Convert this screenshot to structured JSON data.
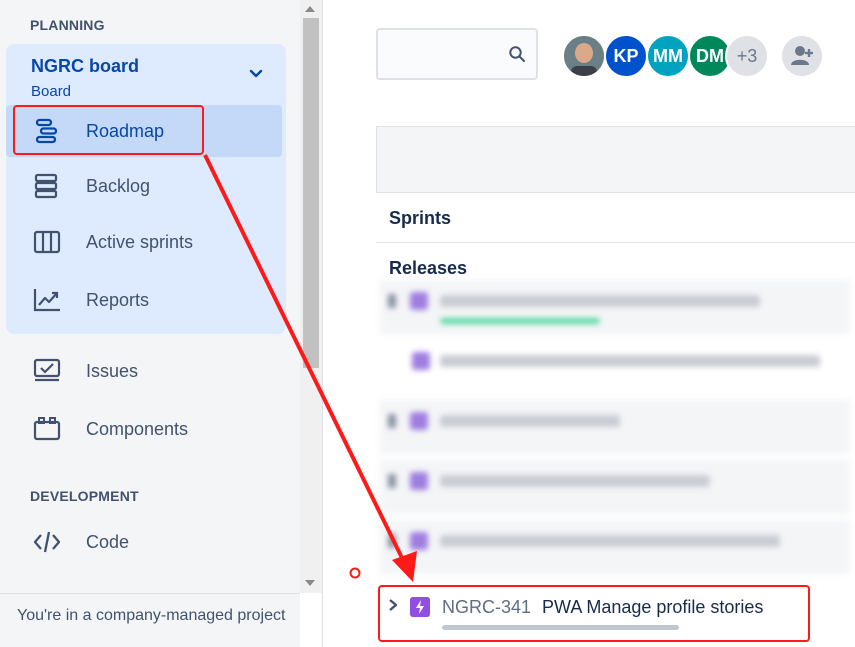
{
  "sidebar": {
    "planning_heading": "PLANNING",
    "board": {
      "title": "NGRC board",
      "subtitle": "Board"
    },
    "planning_items": [
      {
        "label": "Roadmap",
        "icon": "roadmap-icon",
        "active": true
      },
      {
        "label": "Backlog",
        "icon": "backlog-icon"
      },
      {
        "label": "Active sprints",
        "icon": "active-sprints-icon"
      },
      {
        "label": "Reports",
        "icon": "reports-icon"
      }
    ],
    "other_items": [
      {
        "label": "Issues",
        "icon": "issues-icon"
      },
      {
        "label": "Components",
        "icon": "components-icon"
      }
    ],
    "development_heading": "DEVELOPMENT",
    "development_items": [
      {
        "label": "Code",
        "icon": "code-icon"
      }
    ],
    "footer": "You're in a company-managed project"
  },
  "toolbar": {
    "search": {
      "value": "",
      "placeholder": "",
      "icon": "search-icon"
    },
    "avatars": [
      {
        "initials": "",
        "kind": "photo"
      },
      {
        "initials": "KP",
        "color": "#0052cc"
      },
      {
        "initials": "MM",
        "color": "#00a3bf"
      },
      {
        "initials": "DM",
        "color": "#00875a"
      },
      {
        "initials": "+3",
        "color": "#dfe1e6"
      }
    ],
    "add_people_icon": "add-person-icon"
  },
  "roadmap": {
    "rows": [
      "Sprints",
      "Releases"
    ],
    "highlighted_issue": {
      "key": "NGRC-341",
      "summary": "PWA Manage profile stories",
      "type_color": "#904ee2",
      "progress": 0
    }
  },
  "colors": {
    "accent": "#0747a6",
    "annotation": "#ff1a1a",
    "sidebar_bg": "#f4f5f7",
    "active_bg": "#deebff"
  }
}
